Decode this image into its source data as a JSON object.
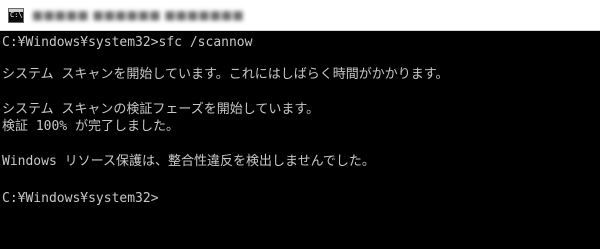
{
  "window": {
    "title": "■■■■■ ■■■■■■ ■■■■■■■",
    "icon_name": "console-icon",
    "icon_glyph": "C:\\"
  },
  "console": {
    "lines": [
      "C:¥Windows¥system32>sfc /scannow",
      "",
      "システム スキャンを開始しています。これにはしばらく時間がかかります。",
      "",
      "システム スキャンの検証フェーズを開始しています。",
      "検証 100% が完了しました。",
      "",
      "Windows リソース保護は、整合性違反を検出しませんでした。",
      "",
      "C:¥Windows¥system32>"
    ],
    "text_color": "#c8c8c8",
    "background_color": "#000000"
  }
}
